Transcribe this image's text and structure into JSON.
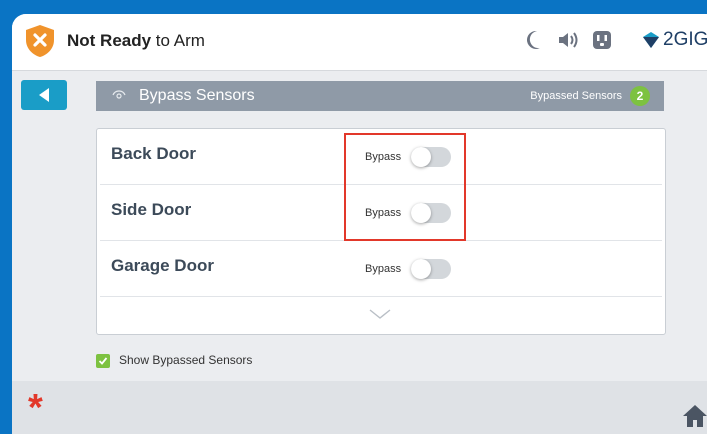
{
  "status": {
    "prefix": "Not Ready",
    "suffix": " to Arm"
  },
  "brand": {
    "name": "2GIG"
  },
  "status_icons": [
    "moon-icon",
    "speaker-icon",
    "outlet-icon"
  ],
  "header": {
    "title": "Bypass Sensors",
    "count_label": "Bypassed Sensors",
    "count": "2"
  },
  "sensors": [
    {
      "name": "Back Door",
      "bypass_label": "Bypass",
      "bypassed": false
    },
    {
      "name": "Side Door",
      "bypass_label": "Bypass",
      "bypassed": false
    },
    {
      "name": "Garage Door",
      "bypass_label": "Bypass",
      "bypassed": false
    }
  ],
  "show_bypassed": {
    "label": "Show Bypassed Sensors",
    "checked": true
  },
  "colors": {
    "accent": "#1a9dc7",
    "alert": "#e2382a",
    "success": "#7dc241",
    "header": "#8f9aa7"
  }
}
